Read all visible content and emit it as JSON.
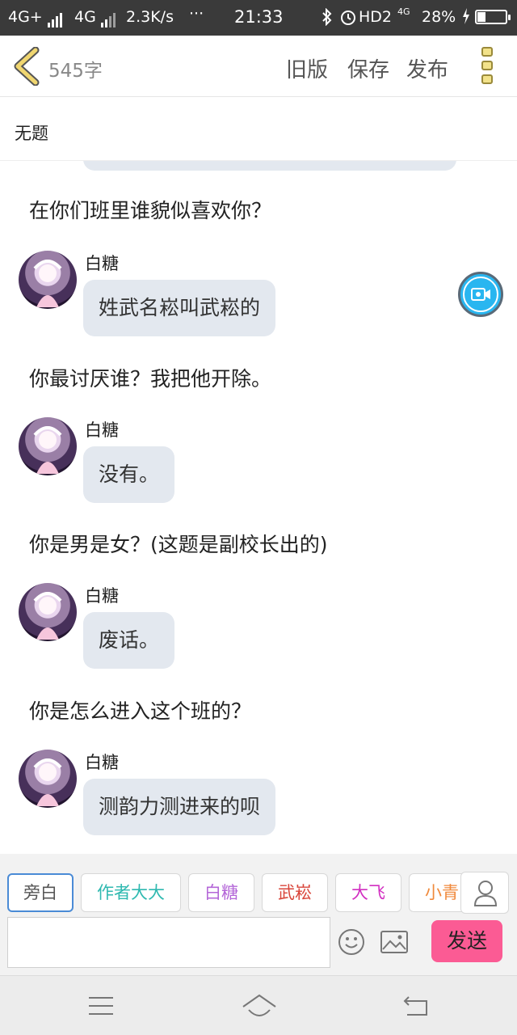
{
  "status_bar": {
    "network1": "4G+",
    "network2": "4G",
    "speed": "2.3K/s",
    "dots": "···",
    "time": "21:33",
    "hd": "HD2",
    "net_small": "4G",
    "battery_percent": "28%",
    "battery_level": 0.28
  },
  "header": {
    "word_count": "545字",
    "old_version": "旧版",
    "save": "保存",
    "publish": "发布"
  },
  "title": "无题",
  "conversation": [
    {
      "question": "在你们班里谁貌似喜欢你？",
      "speaker": "白糖",
      "answer": "姓武名崧叫武崧的"
    },
    {
      "question": "你最讨厌谁？我把他开除。",
      "speaker": "白糖",
      "answer": "没有。"
    },
    {
      "question": "你是男是女？(这题是副校长出的)",
      "speaker": "白糖",
      "answer": "废话。"
    },
    {
      "question": "你是怎么进入这个班的？",
      "speaker": "白糖",
      "answer": "测韵力测进来的呗"
    }
  ],
  "characters": [
    {
      "label": "旁白",
      "color": "#555555"
    },
    {
      "label": "作者大大",
      "color": "#2fb9b0"
    },
    {
      "label": "白糖",
      "color": "#b467d8"
    },
    {
      "label": "武崧",
      "color": "#d9463b"
    },
    {
      "label": "大飞",
      "color": "#d22fc1"
    },
    {
      "label": "小青",
      "color": "#f08a3c"
    }
  ],
  "composer": {
    "input_value": "",
    "send_label": "发送"
  },
  "colors": {
    "bubble": "#e3e8ef",
    "send": "#fb5b94",
    "selected_chip_border": "#4a8bd6",
    "camera": "#29b6f0"
  }
}
